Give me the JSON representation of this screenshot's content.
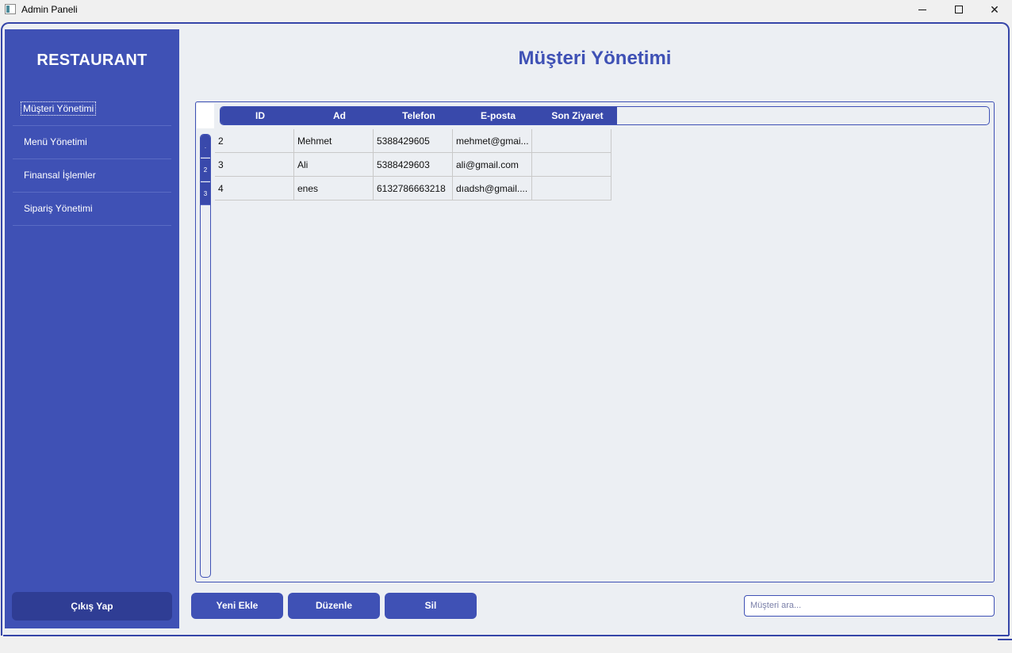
{
  "window": {
    "title": "Admin Paneli"
  },
  "sidebar": {
    "brand": "RESTAURANT",
    "items": [
      {
        "label": "Müşteri Yönetimi",
        "active": true
      },
      {
        "label": "Menü Yönetimi",
        "active": false
      },
      {
        "label": "Finansal İşlemler",
        "active": false
      },
      {
        "label": "Sipariş Yönetimi",
        "active": false
      }
    ],
    "logout_label": "Çıkış Yap"
  },
  "main": {
    "title": "Müşteri Yönetimi",
    "table": {
      "columns": [
        "ID",
        "Ad",
        "Telefon",
        "E-posta",
        "Son Ziyaret"
      ],
      "rows": [
        [
          "2",
          "Mehmet",
          "5388429605",
          "mehmet@gmai...",
          ""
        ],
        [
          "3",
          "Ali",
          "5388429603",
          "ali@gmail.com",
          ""
        ],
        [
          "4",
          "enes",
          "6132786663218",
          "dıadsh@gmail....",
          ""
        ]
      ],
      "row_headers": [
        ".",
        "2",
        "3"
      ]
    },
    "actions": {
      "add": "Yeni Ekle",
      "edit": "Düzenle",
      "delete": "Sil"
    },
    "search": {
      "placeholder": "Müşteri ara..."
    }
  },
  "colors": {
    "accent": "#3f51b5",
    "header": "#3949ab",
    "logout": "#2f3d94",
    "background": "#eceff3"
  },
  "icons": {
    "app": "app-window-icon",
    "minimize": "minimize-icon",
    "maximize": "maximize-icon",
    "close": "close-icon"
  }
}
